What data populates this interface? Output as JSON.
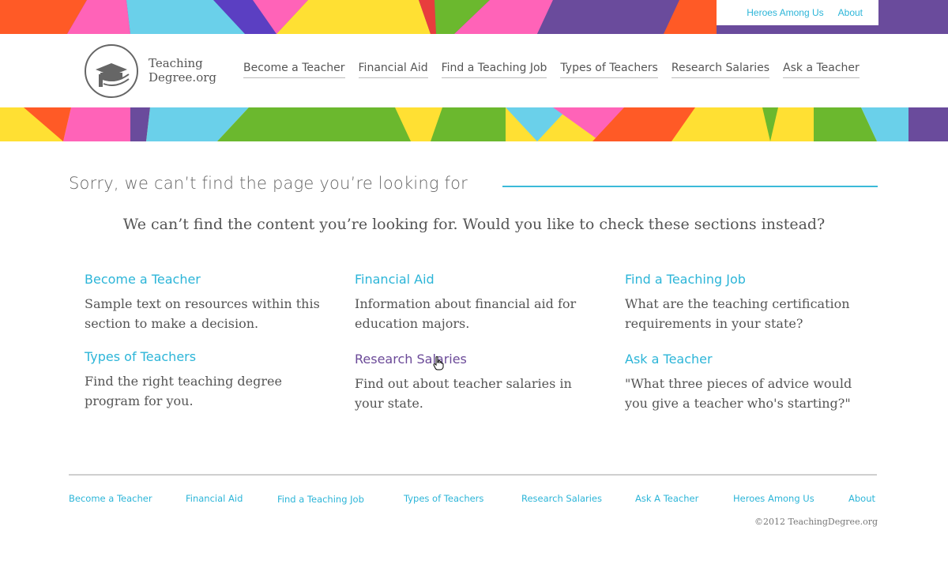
{
  "colors": {
    "accent": "#2cb5d8",
    "visited": "#6b4a98",
    "text": "#555555",
    "band": [
      "#ff5a26",
      "#ff63b8",
      "#6ad0ea",
      "#5b3fc2",
      "#ffe033",
      "#6a4b9c",
      "#6bb82e",
      "#e83d3d"
    ]
  },
  "utility_nav": [
    {
      "label": "Heroes Among Us"
    },
    {
      "label": "About"
    }
  ],
  "logo": {
    "line1": "Teaching",
    "line2": "Degree.org",
    "icon": "book-cap-icon"
  },
  "main_nav": [
    {
      "label": "Become a Teacher"
    },
    {
      "label": "Financial Aid"
    },
    {
      "label": "Find a Teaching Job"
    },
    {
      "label": "Types of Teachers"
    },
    {
      "label": "Research Salaries"
    },
    {
      "label": "Ask a Teacher"
    }
  ],
  "error": {
    "title": "Sorry, we can’t find the page you’re looking for",
    "lead": "We can’t find the content you’re looking for. Would you like to check these sections instead?"
  },
  "sections": [
    {
      "title": "Become a Teacher",
      "desc": "Sample text on resources within this section to make a decision."
    },
    {
      "title": "Financial Aid",
      "desc": "Information about financial aid for education majors."
    },
    {
      "title": "Find a Teaching Job",
      "desc": "What are the teaching certification requirements in your state?"
    },
    {
      "title": "Types of Teachers",
      "desc": "Find the right teaching degree program for you."
    },
    {
      "title": "Research Salaries",
      "desc": "Find out about teacher salaries in your state."
    },
    {
      "title": "Ask a Teacher",
      "desc": "\"What three pieces of advice would you give a teacher who's starting?\""
    }
  ],
  "footer_nav": [
    {
      "label": "Become a Teacher"
    },
    {
      "label": "Financial Aid"
    },
    {
      "label": "Find a Teaching Job"
    },
    {
      "label": "Types of Teachers"
    },
    {
      "label": "Research Salaries"
    },
    {
      "label": "Ask A Teacher"
    },
    {
      "label": "Heroes Among Us"
    },
    {
      "label": "About"
    }
  ],
  "copyright": "©2012 TeachingDegree.org"
}
